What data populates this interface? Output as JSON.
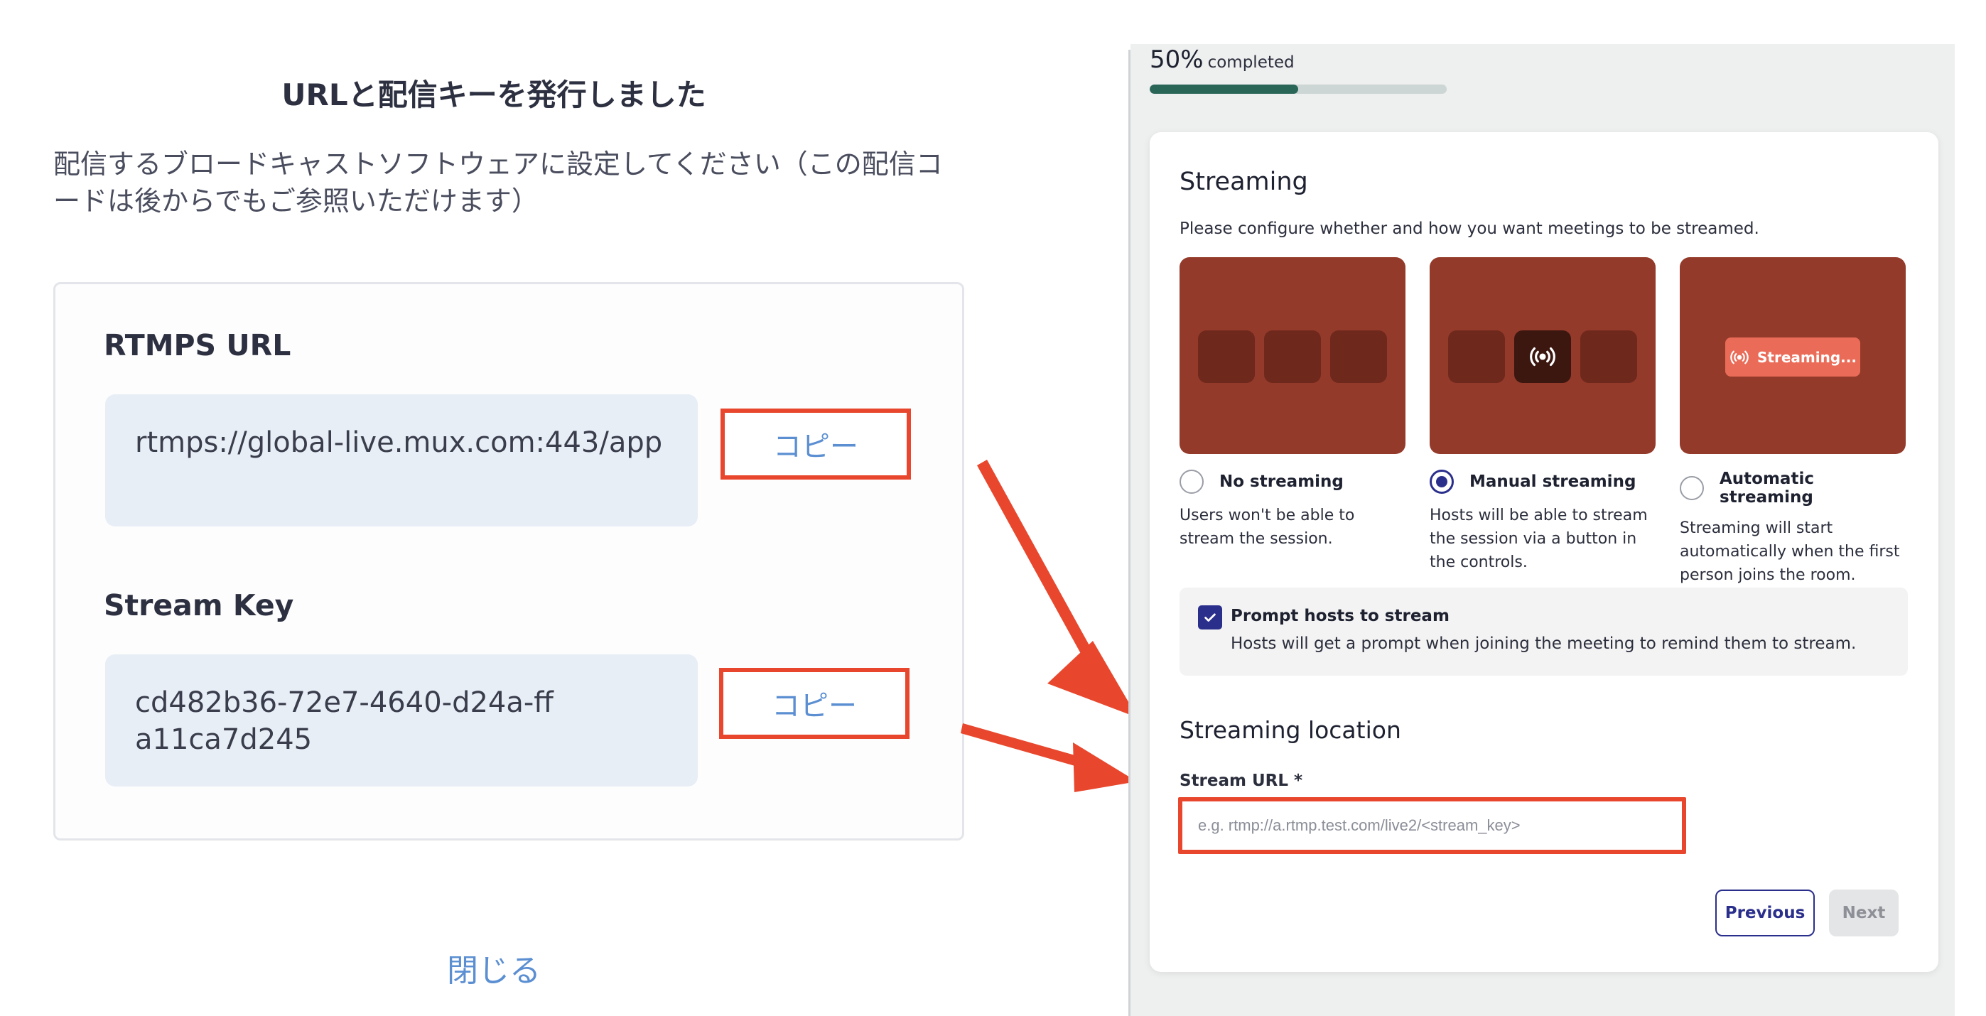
{
  "left": {
    "title": "URLと配信キーを発行しました",
    "description": "配信するブロードキャストソフトウェアに設定してください（この配信コードは後からでもご参照いただけます）",
    "rtmps": {
      "label": "RTMPS URL",
      "value": "rtmps://global-live.mux.com:443/app",
      "copy_label": "コピー"
    },
    "stream_key": {
      "label": "Stream Key",
      "value": "cd482b36-72e7-4640-d24a-ffa11ca7d245",
      "copy_label": "コピー"
    },
    "close_label": "閉じる",
    "highlight_color": "#e8472d"
  },
  "right": {
    "progress": {
      "percent_text": "50%",
      "completed_label": "completed",
      "fraction": 0.5
    },
    "streaming": {
      "title": "Streaming",
      "description": "Please configure whether and how you want meetings to be streamed.",
      "options": [
        {
          "name": "No streaming",
          "description": "Users won't be able to stream the session.",
          "selected": false
        },
        {
          "name": "Manual streaming",
          "description": "Hosts will be able to stream the session via a button in the controls.",
          "selected": true
        },
        {
          "name": "Automatic streaming",
          "description": "Streaming will start automatically when the first person joins the room.",
          "selected": false,
          "pill_label": "Streaming..."
        }
      ],
      "prompt": {
        "title": "Prompt hosts to stream",
        "description": "Hosts will get a prompt when joining the meeting to remind them to stream.",
        "checked": true
      }
    },
    "location": {
      "title": "Streaming location",
      "url_label": "Stream URL *",
      "url_placeholder": "e.g. rtmp://a.rtmp.test.com/live2/<stream_key>",
      "url_value": ""
    },
    "buttons": {
      "previous": "Previous",
      "next": "Next"
    },
    "accent_color": "#2b2f8c",
    "tile_color": "#943a2a"
  }
}
